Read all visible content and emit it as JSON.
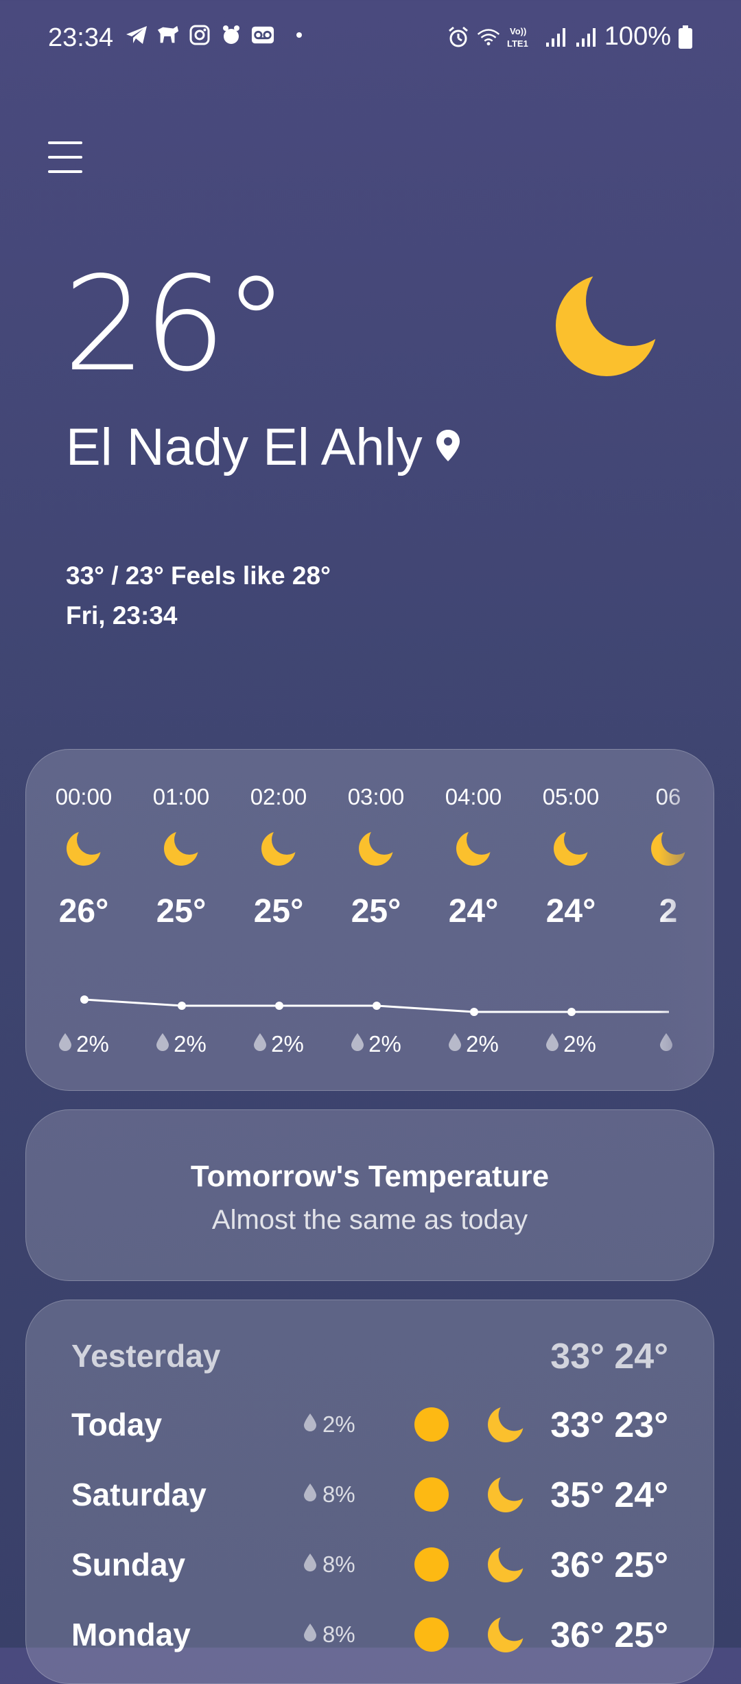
{
  "status_bar": {
    "time": "23:34",
    "left_icons": [
      "telegram-icon",
      "dog-app-icon",
      "instagram-icon",
      "bird-app-icon",
      "voicemail-icon"
    ],
    "right_icons": [
      "alarm-icon",
      "wifi-icon",
      "volte-lte1-icon",
      "signal-1-icon",
      "signal-2-icon",
      "battery-icon"
    ],
    "volte_label": "Vo))\nLTE1",
    "battery": "100%"
  },
  "current": {
    "temperature": "26°",
    "location": "El Nady El Ahly",
    "hi_lo_feels": "33° / 23° Feels like 28°",
    "datetime": "Fri, 23:34",
    "condition_icon": "moon-icon"
  },
  "hourly": [
    {
      "time": "00:00",
      "temp": "26°",
      "precip": "2%",
      "temp_value": 26
    },
    {
      "time": "01:00",
      "temp": "25°",
      "precip": "2%",
      "temp_value": 25
    },
    {
      "time": "02:00",
      "temp": "25°",
      "precip": "2%",
      "temp_value": 25
    },
    {
      "time": "03:00",
      "temp": "25°",
      "precip": "2%",
      "temp_value": 25
    },
    {
      "time": "04:00",
      "temp": "24°",
      "precip": "2%",
      "temp_value": 24
    },
    {
      "time": "05:00",
      "temp": "24°",
      "precip": "2%",
      "temp_value": 24
    },
    {
      "time": "06",
      "temp": "2",
      "precip": "",
      "temp_value": 24
    }
  ],
  "tomorrow": {
    "title": "Tomorrow's Temperature",
    "subtitle": "Almost the same as today"
  },
  "daily": [
    {
      "day": "Yesterday",
      "precip": "",
      "temps": "33° 24°"
    },
    {
      "day": "Today",
      "precip": "2%",
      "temps": "33° 23°"
    },
    {
      "day": "Saturday",
      "precip": "8%",
      "temps": "35° 24°"
    },
    {
      "day": "Sunday",
      "precip": "8%",
      "temps": "36° 25°"
    },
    {
      "day": "Monday",
      "precip": "8%",
      "temps": "36° 25°"
    }
  ],
  "colors": {
    "sun": "#fdb913",
    "moon": "#fbc02d",
    "background_top": "#4a4a7e",
    "background_bottom": "#394069"
  }
}
